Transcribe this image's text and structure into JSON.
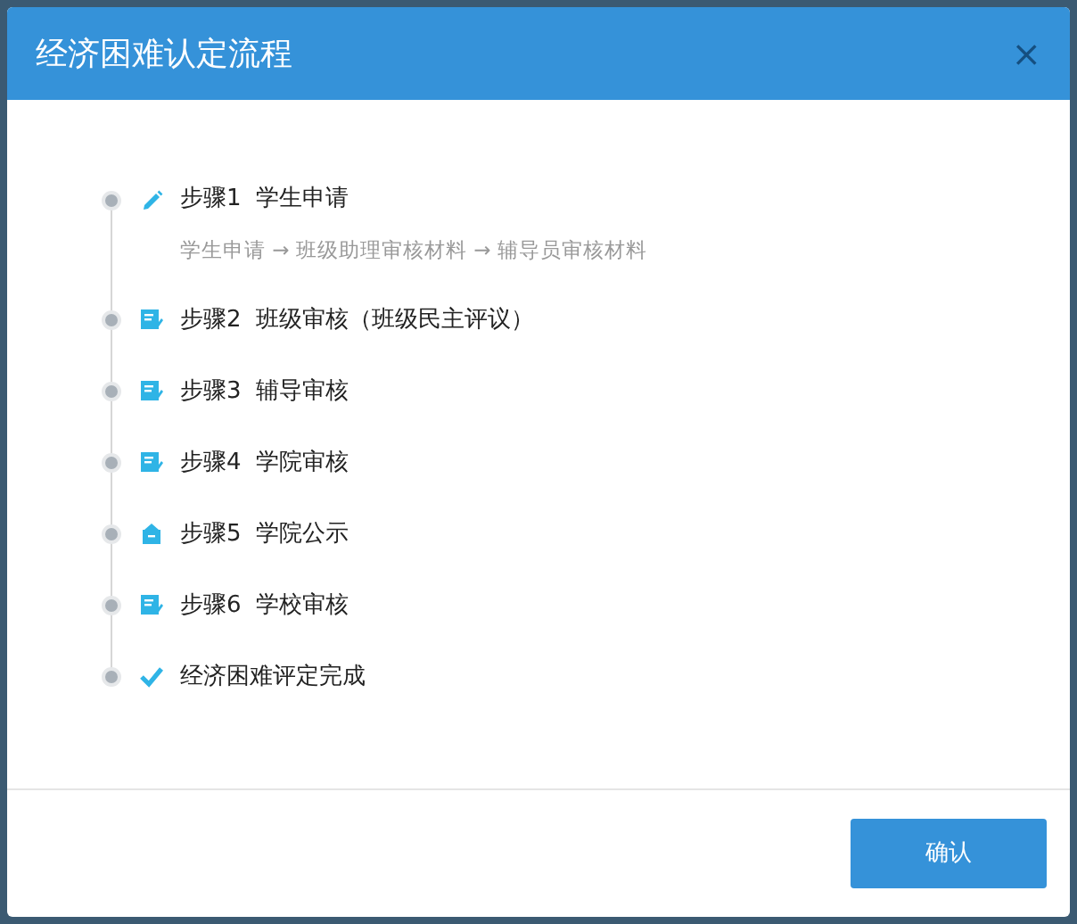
{
  "dialog": {
    "title": "经济困难认定流程",
    "close": "×"
  },
  "steps": [
    {
      "kind": "pencil",
      "text": "步骤1  学生申请",
      "detail": "学生申请 → 班级助理审核材料 → 辅导员审核材料"
    },
    {
      "kind": "doc",
      "text": "步骤2  班级审核（班级民主评议）"
    },
    {
      "kind": "doc",
      "text": "步骤3  辅导审核"
    },
    {
      "kind": "doc",
      "text": "步骤4  学院审核"
    },
    {
      "kind": "notice",
      "text": "步骤5  学院公示"
    },
    {
      "kind": "doc",
      "text": "步骤6  学校审核"
    },
    {
      "kind": "check",
      "text": "经济困难评定完成"
    }
  ],
  "buttons": [
    "确认"
  ]
}
